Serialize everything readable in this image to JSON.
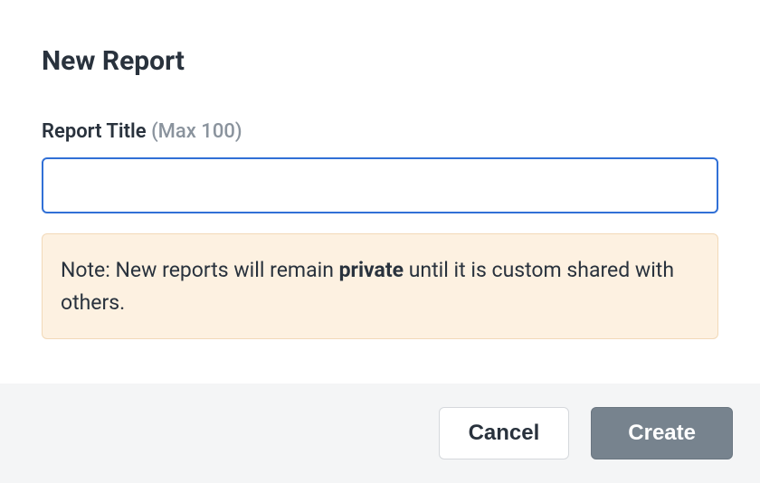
{
  "dialog": {
    "title": "New Report",
    "field": {
      "label": "Report Title",
      "hint": "(Max 100)",
      "value": ""
    },
    "note": {
      "prefix": "Note: New reports will remain ",
      "bold": "private",
      "suffix": " until it is custom shared with others."
    },
    "buttons": {
      "cancel": "Cancel",
      "create": "Create"
    }
  }
}
